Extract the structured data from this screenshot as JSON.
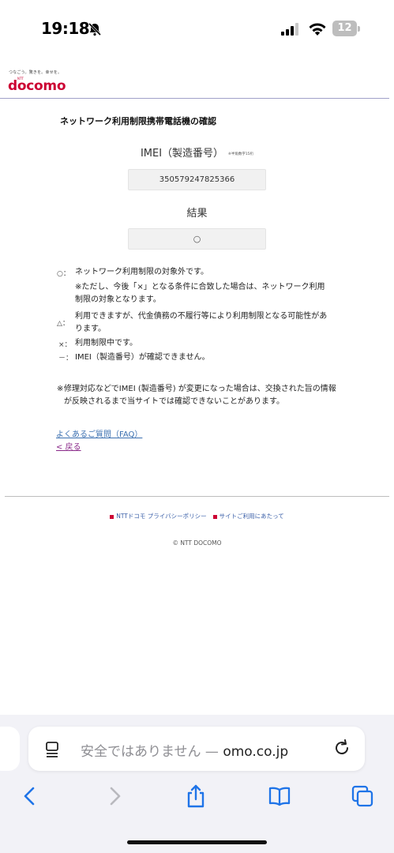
{
  "status_bar": {
    "time": "19:18",
    "battery": "12"
  },
  "header": {
    "tagline": "つなごう。驚きを。幸せを。",
    "logo_small": "NTT",
    "logo": "docomo"
  },
  "page": {
    "title": "ネットワーク利用制限携帯電話機の確認",
    "imei_label": "IMEI（製造番号）",
    "imei_note": "※半角数字15桁",
    "imei_value": "350579247825366",
    "result_label": "結果",
    "result_value": "○"
  },
  "legend": {
    "circle_symbol": "○：",
    "circle_text": "ネットワーク利用制限の対象外です。",
    "circle_note": "※ただし、今後「×」となる条件に合致した場合は、ネットワーク利用制限の対象となります。",
    "triangle_symbol": "△：",
    "triangle_text": "利用できますが、代金債務の不履行等により利用制限となる可能性があります。",
    "cross_symbol": "×：",
    "cross_text": "利用制限中です。",
    "dash_symbol": "－：",
    "dash_text": "IMEI（製造番号）が確認できません。"
  },
  "footnote": {
    "asterisk": "※",
    "text": "修理対応などでIMEI (製造番号) が変更になった場合は、交換された旨の情報が反映されるまで当サイトでは確認できないことがあります。"
  },
  "links": {
    "faq": "よくあるご質問（FAQ）",
    "back": "< 戻る"
  },
  "footer": {
    "privacy": "NTTドコモ プライバシーポリシー",
    "terms": "サイトご利用にあたって",
    "copyright": "© NTT DOCOMO"
  },
  "browser": {
    "address_warning": "安全ではありません — ",
    "address_domain": "omo.co.jp"
  }
}
